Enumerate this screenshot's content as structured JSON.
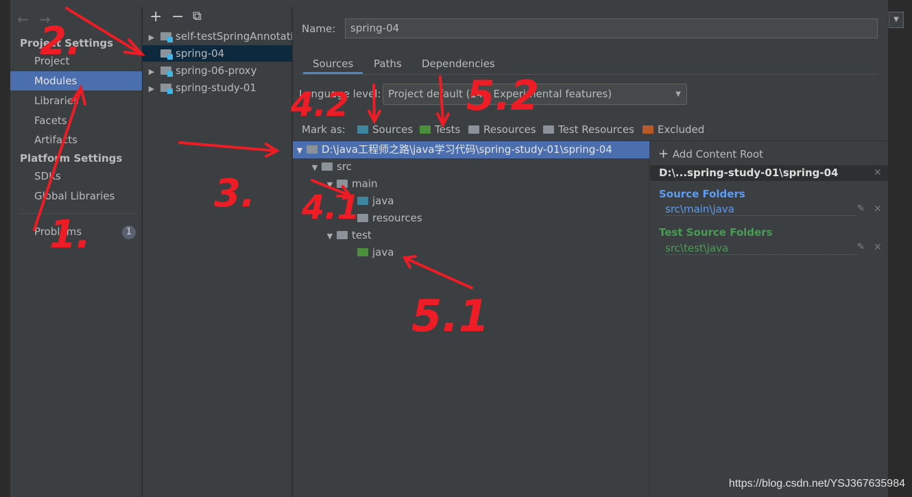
{
  "nav": {
    "back": "←",
    "forward": "→"
  },
  "sidebar": {
    "project_settings": "Project Settings",
    "items": [
      {
        "label": "Project"
      },
      {
        "label": "Modules",
        "selected": true
      },
      {
        "label": "Libraries"
      },
      {
        "label": "Facets"
      },
      {
        "label": "Artifacts"
      }
    ],
    "platform_settings": "Platform Settings",
    "platform_items": [
      {
        "label": "SDKs"
      },
      {
        "label": "Global Libraries"
      }
    ],
    "problems": {
      "label": "Problems",
      "count": "1"
    }
  },
  "modules": {
    "toolbar": {
      "add": "+",
      "remove": "−",
      "copy": "⧉"
    },
    "items": [
      {
        "label": "self-testSpringAnnotati",
        "expandable": true
      },
      {
        "label": "spring-04",
        "selected": true
      },
      {
        "label": "spring-06-proxy",
        "expandable": true
      },
      {
        "label": "spring-study-01",
        "expandable": true
      }
    ]
  },
  "main": {
    "name_label": "Name:",
    "name_value": "spring-04",
    "tabs": [
      {
        "label": "Sources",
        "active": true
      },
      {
        "label": "Paths"
      },
      {
        "label": "Dependencies"
      }
    ],
    "language_level_label": "Language level:",
    "language_level_value": "Project default (14 - Experimental features)",
    "mark_as_label": "Mark as:",
    "mark_as": [
      {
        "label": "Sources",
        "color": "#3e86a0"
      },
      {
        "label": "Tests",
        "color": "#4a8f3c"
      },
      {
        "label": "Resources"
      },
      {
        "label": "Test Resources"
      },
      {
        "label": "Excluded",
        "color": "#b85a2a"
      }
    ]
  },
  "tree": [
    {
      "label": "D:\\java工程师之路\\java学习代码\\spring-study-01\\spring-04",
      "selected": true
    },
    {
      "label": "src"
    },
    {
      "label": "main"
    },
    {
      "label": "java",
      "type": "source"
    },
    {
      "label": "resources"
    },
    {
      "label": "test"
    },
    {
      "label": "java",
      "type": "test"
    }
  ],
  "content_root": {
    "add_label": "Add Content Root",
    "root_path": "D:\\...spring-study-01\\spring-04",
    "source_folders_title": "Source Folders",
    "source_folders": [
      "src\\main\\java"
    ],
    "test_folders_title": "Test Source Folders",
    "test_folders": [
      "src\\test\\java"
    ],
    "source_color": "#5c9cf5",
    "test_color": "#499c54"
  },
  "annotations": [
    "1.",
    "2.",
    "3.",
    "4.1",
    "4.2",
    "5.1",
    "5.2"
  ],
  "watermark": "https://blog.csdn.net/YSJ367635984"
}
